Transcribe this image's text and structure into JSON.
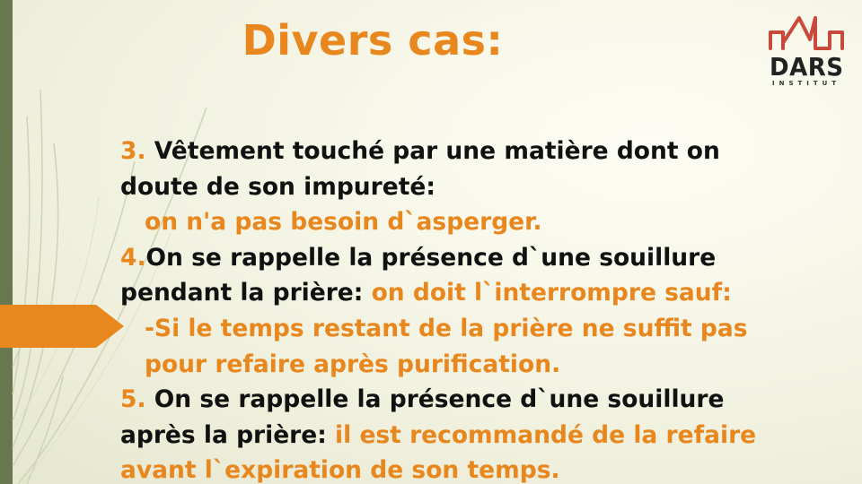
{
  "slide": {
    "title": "Divers cas:",
    "logo": {
      "name": "DARS",
      "sub": "INSTITUT"
    },
    "colors": {
      "accent": "#e8871e",
      "sidebar": "#67784f",
      "text": "#111111"
    },
    "items": [
      {
        "num": "3.",
        "text": " Vêtement touché par une matière dont on",
        "text2": "doute de son impureté:",
        "answer": "on n'a pas besoin d`asperger."
      },
      {
        "num": "4.",
        "text": "On se rappelle la présence d`une souillure",
        "text2": "pendant la prière: ",
        "text2_orange": "on doit l`interrompre sauf:",
        "sub1": "-Si le temps restant de la prière ne suffit pas",
        "sub2": "pour refaire après purification."
      },
      {
        "num": "5.",
        "text": " On se rappelle la présence d`une souillure",
        "text2": "après la prière: ",
        "text2_orange": "il est recommandé de la refaire",
        "text3": "avant l`expiration de son temps."
      }
    ]
  }
}
